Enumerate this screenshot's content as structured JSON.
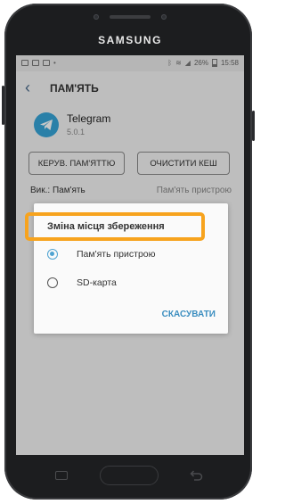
{
  "device": {
    "brand": "SAMSUNG"
  },
  "status_bar": {
    "battery": "26%",
    "time": "15:58"
  },
  "app_bar": {
    "title": "ПАМ'ЯТЬ"
  },
  "app_info": {
    "name": "Telegram",
    "version": "5.0.1"
  },
  "buttons": {
    "manage_storage": "КЕРУВ. ПАМ'ЯТТЮ",
    "clear_cache": "ОЧИСТИТИ КЕШ"
  },
  "storage_row": {
    "label": "Вик.: Пам'ять",
    "value": "Пам'ять пристрою"
  },
  "dialog": {
    "title": "Зміна місця збереження",
    "options": [
      {
        "label": "Пам'ять пристрою",
        "selected": true
      },
      {
        "label": "SD-карта",
        "selected": false
      }
    ],
    "cancel_label": "СКАСУВАТИ"
  },
  "colors": {
    "accent": "#4fa3d1",
    "highlight": "#f7a31d",
    "telegram": "#37a4d8"
  }
}
